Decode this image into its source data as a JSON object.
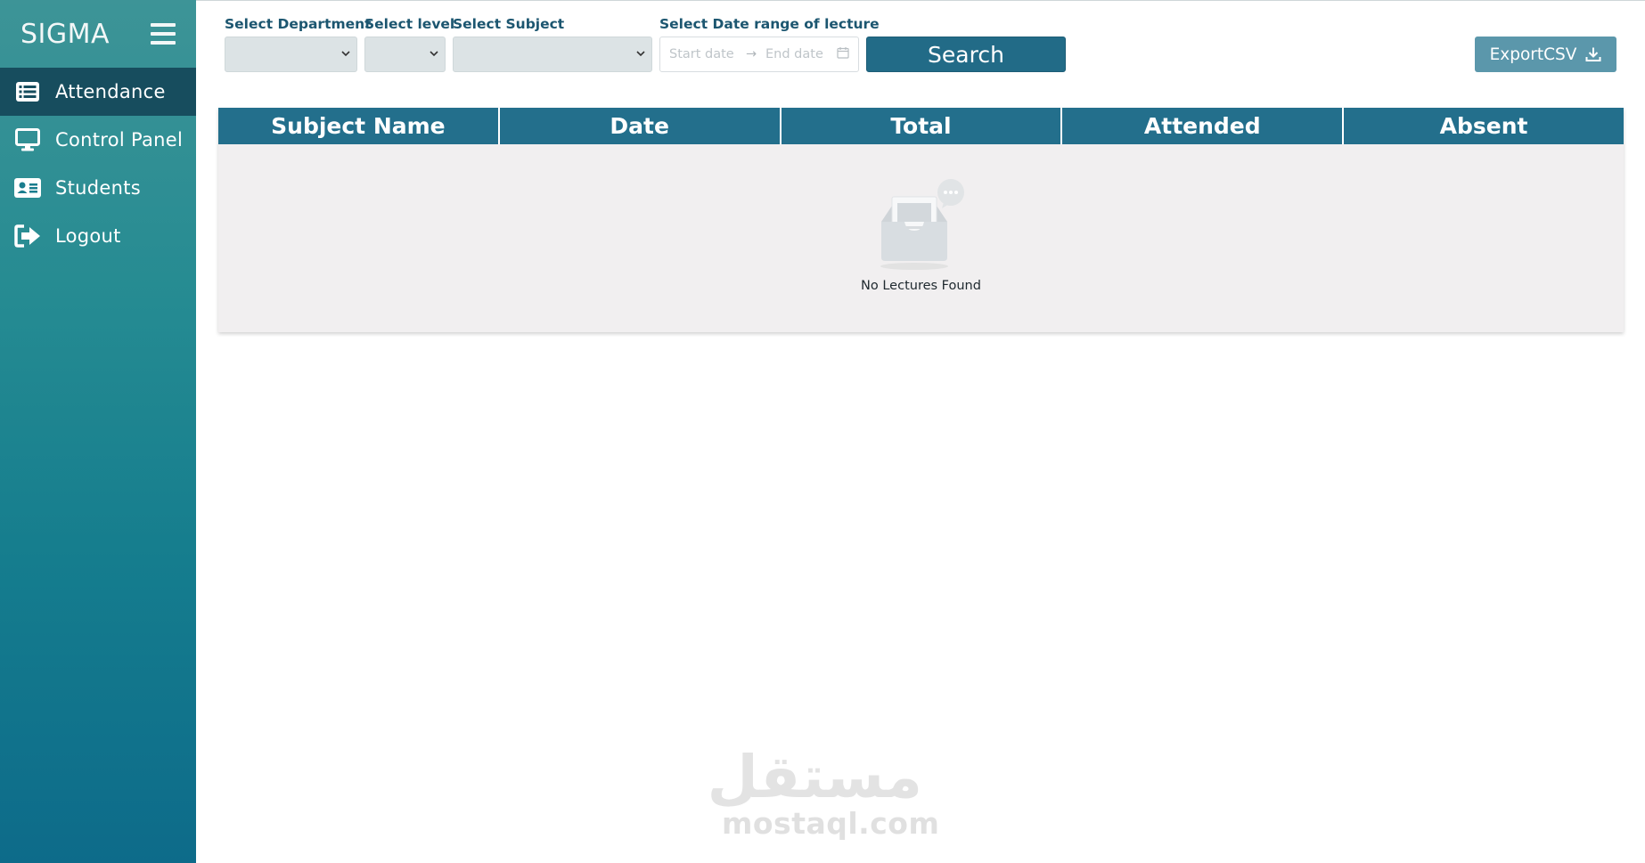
{
  "sidebar": {
    "brand": "SIGMA",
    "items": [
      {
        "label": "Attendance",
        "icon": "list-icon",
        "active": true
      },
      {
        "label": "Control Panel",
        "icon": "monitor-icon",
        "active": false
      },
      {
        "label": "Students",
        "icon": "id-card-icon",
        "active": false
      },
      {
        "label": "Logout",
        "icon": "logout-icon",
        "active": false
      }
    ]
  },
  "filters": {
    "department_label": "Select Department",
    "level_label": "Select level",
    "subject_label": "Select Subject",
    "date_range_label": "Select Date range of lecture",
    "start_placeholder": "Start date",
    "end_placeholder": "End date",
    "arrow": "→",
    "search_label": "Search"
  },
  "export": {
    "label": "ExportCSV",
    "icon": "download-icon"
  },
  "table": {
    "columns": [
      "Subject Name",
      "Date",
      "Total",
      "Attended",
      "Absent"
    ],
    "empty_text": "No Lectures Found"
  },
  "watermark": {
    "arabic": "مستقل",
    "latin": "mostaql.com"
  },
  "colors": {
    "sidebar_active": "#174d5e",
    "primary": "#226b87",
    "export": "#5b97ab",
    "table_header": "#236f8c",
    "label_text": "#1c5670"
  }
}
